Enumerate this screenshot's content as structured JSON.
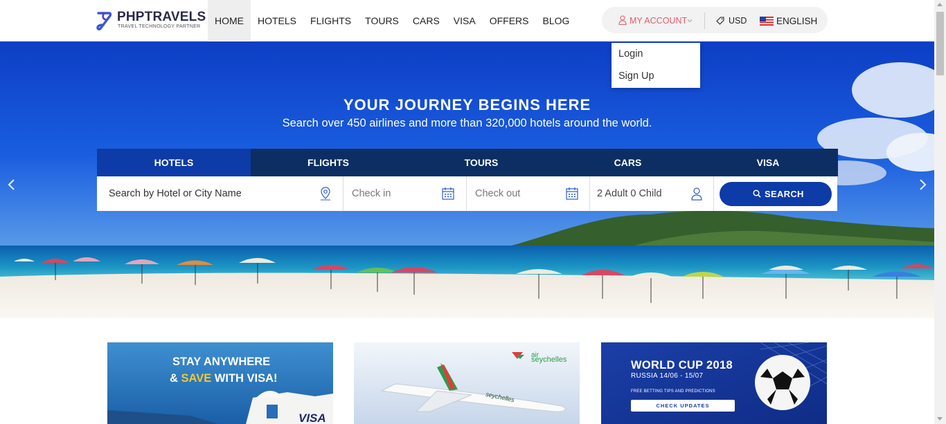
{
  "brand": {
    "name": "PHPTRAVELS",
    "tagline": "TRAVEL TECHNOLOGY PARTNER"
  },
  "nav": {
    "items": [
      {
        "label": "HOME",
        "active": true
      },
      {
        "label": "HOTELS"
      },
      {
        "label": "FLIGHTS"
      },
      {
        "label": "TOURS"
      },
      {
        "label": "CARS"
      },
      {
        "label": "VISA"
      },
      {
        "label": "OFFERS"
      },
      {
        "label": "BLOG"
      }
    ]
  },
  "account": {
    "label": "MY ACCOUNT",
    "currency": "USD",
    "language": "ENGLISH",
    "menu": [
      "Login",
      "Sign Up"
    ]
  },
  "hero": {
    "title": "YOUR JOURNEY BEGINS HERE",
    "subtitle": "Search over 450 airlines and more than 320,000 hotels around the world."
  },
  "search": {
    "tabs": [
      "HOTELS",
      "FLIGHTS",
      "TOURS",
      "CARS",
      "VISA"
    ],
    "active_tab": "HOTELS",
    "location_placeholder": "Search by Hotel or City Name",
    "checkin_placeholder": "Check in",
    "checkout_placeholder": "Check out",
    "guests": "2 Adult 0 Child",
    "button": "SEARCH"
  },
  "promos": [
    {
      "line1": "STAY ANYWHERE",
      "line2_pre": "& ",
      "line2_highlight": "SAVE",
      "line2_post": " WITH VISA!",
      "badge": "VISA"
    },
    {
      "brand_top": "air",
      "brand_bottom": "seychelles",
      "livery": "seychelles"
    },
    {
      "title": "WORLD CUP 2018",
      "subtitle": "RUSSIA 14/06 - 15/07",
      "note": "FREE BETTING TIPS AND PREDICTIONS",
      "button": "CHECK UPDATES"
    }
  ],
  "colors": {
    "primary": "#0d3ba8",
    "tab_bar": "#0c2e63",
    "account": "#e75a6b",
    "highlight": "#f7c82b"
  }
}
